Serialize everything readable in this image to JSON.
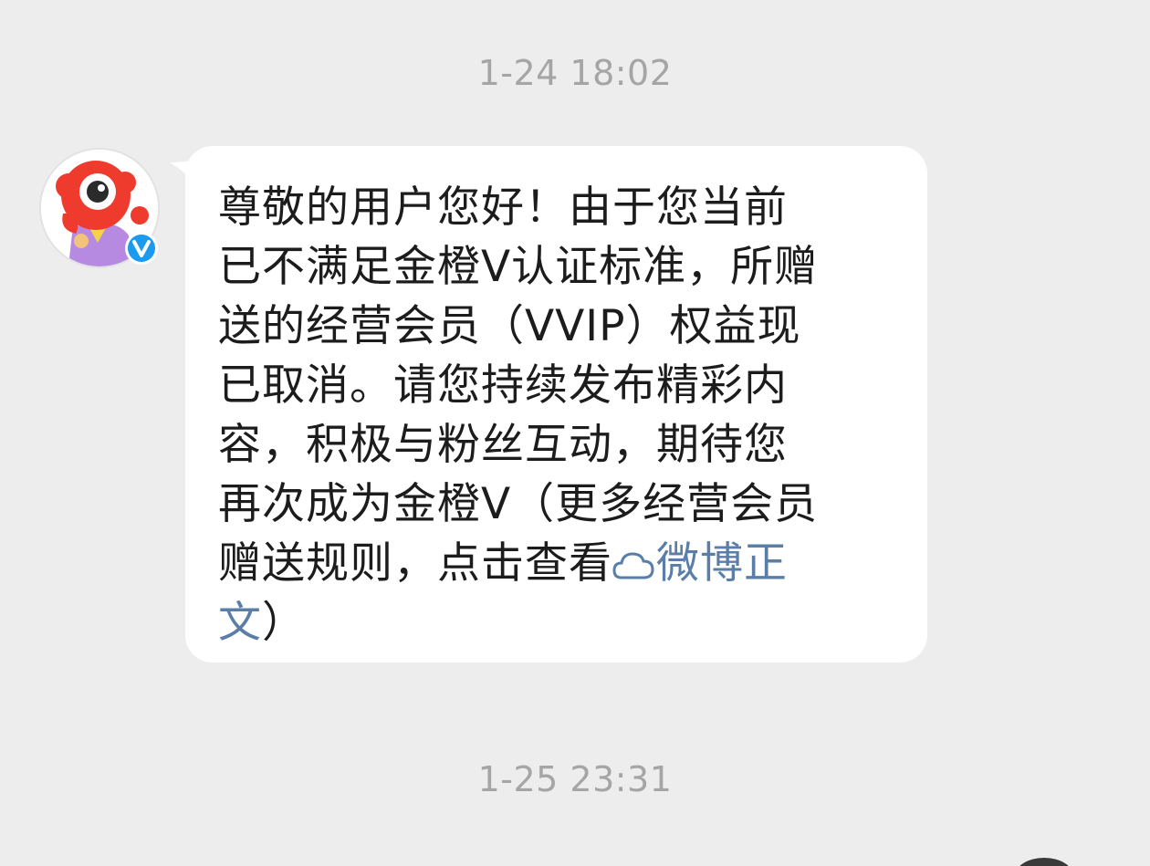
{
  "timestamps": {
    "first": "1-24 18:02",
    "second": "1-25 23:31"
  },
  "sender": {
    "avatar_icon": "weibo-mascot-avatar",
    "verified_icon": "verified-v-badge",
    "verified_mark": "V",
    "verified_color": "#1a9bf0"
  },
  "message": {
    "lines": [
      "尊敬的用户您好！由于您当前",
      "已不满足金橙V认证标准，所赠",
      "送的经营会员（VVIP）权益现",
      "已取消。请您持续发布精彩内",
      "容，积极与粉丝互动，期待您",
      "再次成为金橙V（更多经营会员"
    ],
    "line7_prefix": "赠送规则，点击查看",
    "link_text_part1": "微博正",
    "link_text_part2": "文",
    "suffix": "）",
    "link_icon": "weibo-cloud-link-icon",
    "link_color": "#5a7ea8"
  }
}
